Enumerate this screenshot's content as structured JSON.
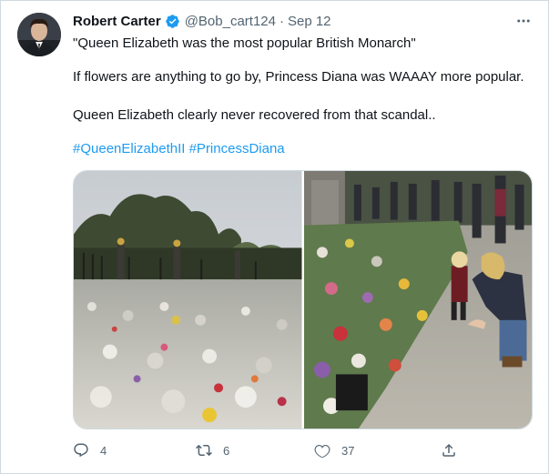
{
  "tweet": {
    "author": {
      "name": "Robert Carter",
      "handle": "@Bob_cart124",
      "verified": true,
      "avatar_icon": "profile-photo"
    },
    "separator": "·",
    "date": "Sep 12",
    "lines": [
      "\"Queen Elizabeth was the most popular British Monarch\"",
      "If flowers are anything to go by, Princess Diana was WAAAY more popular.",
      "Queen Elizabeth clearly never recovered from that scandal.."
    ],
    "hashtags": [
      "#QueenElizabethII",
      "#PrincessDiana"
    ],
    "media": [
      {
        "icon": "flowers-at-palace-gates-photo"
      },
      {
        "icon": "child-and-woman-laying-flowers-photo"
      }
    ],
    "actions": {
      "reply_count": "4",
      "retweet_count": "6",
      "like_count": "37"
    }
  },
  "colors": {
    "accent": "#1d9bf0",
    "text": "#0f1419",
    "secondary": "#536471",
    "border": "#cfd9de"
  }
}
